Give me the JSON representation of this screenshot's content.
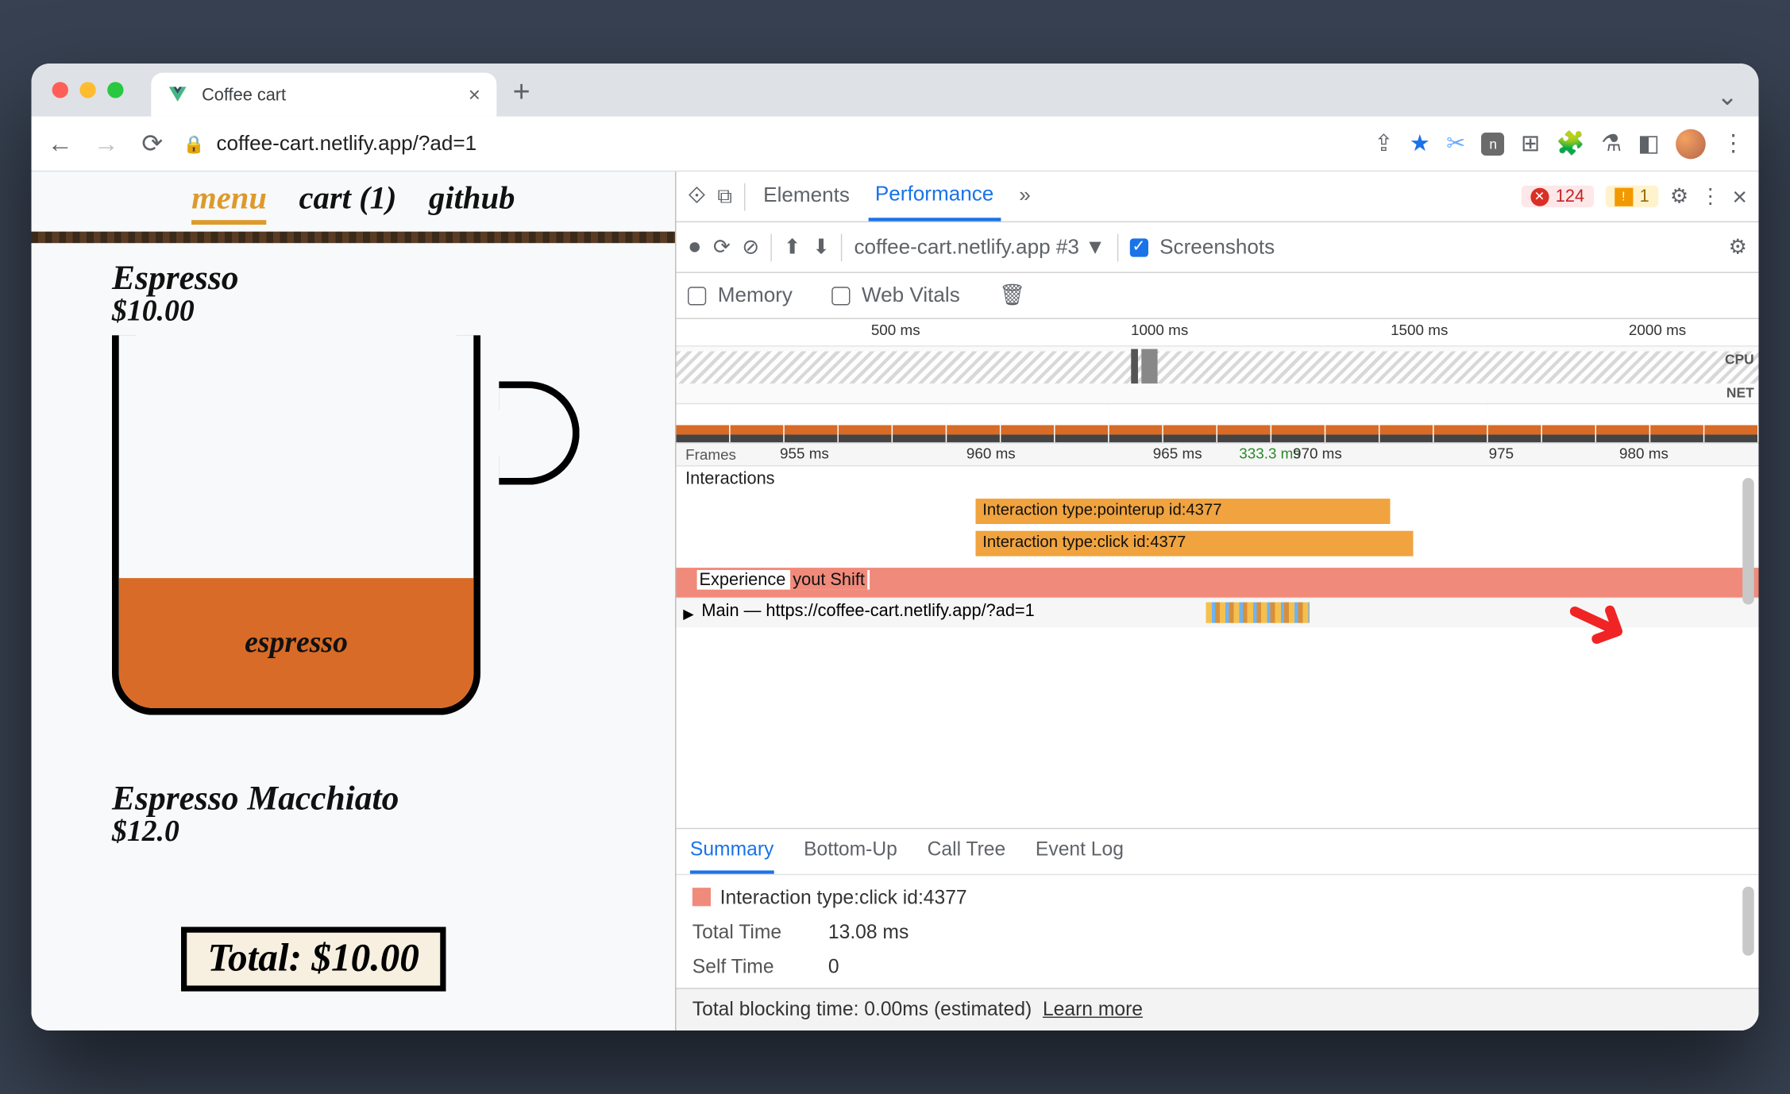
{
  "browser": {
    "tab_title": "Coffee cart",
    "url": "coffee-cart.netlify.app/?ad=1"
  },
  "page": {
    "nav": {
      "menu": "menu",
      "cart": "cart (1)",
      "github": "github"
    },
    "product1": {
      "name": "Espresso",
      "price": "$10.00",
      "fill_label": "espresso"
    },
    "product2": {
      "name": "Espresso Macchiato",
      "price": "$12.0"
    },
    "total_label": "Total: $10.00"
  },
  "devtools": {
    "tabs": {
      "elements": "Elements",
      "performance": "Performance",
      "more": "»"
    },
    "errors": "124",
    "warnings": "1",
    "recording_select": "coffee-cart.netlify.app #3",
    "screenshots_label": "Screenshots",
    "memory_label": "Memory",
    "webvitals_label": "Web Vitals",
    "overview_ticks": {
      "t1": "500 ms",
      "t2": "1000 ms",
      "t3": "1500 ms",
      "t4": "2000 ms"
    },
    "overview_labels": {
      "cpu": "CPU",
      "net": "NET"
    },
    "frames_label": "Frames",
    "frames_fps": "333.3 ms",
    "ruler_ticks": {
      "a": "955 ms",
      "b": "960 ms",
      "c": "965 ms",
      "d": "970 ms",
      "e": "975",
      "f": "980 ms"
    },
    "interactions_label": "Interactions",
    "interaction1": "Interaction type:pointerup id:4377",
    "interaction2": "Interaction type:click id:4377",
    "experience_label": "Experience",
    "experience_text": "yout Shift",
    "main_label": "Main — https://coffee-cart.netlify.app/?ad=1",
    "bottom_tabs": {
      "summary": "Summary",
      "bottomup": "Bottom-Up",
      "calltree": "Call Tree",
      "eventlog": "Event Log"
    },
    "summary": {
      "title": "Interaction type:click id:4377",
      "total_k": "Total Time",
      "total_v": "13.08 ms",
      "self_k": "Self Time",
      "self_v": "0"
    },
    "footer": {
      "text": "Total blocking time: 0.00ms (estimated)",
      "learn": "Learn more"
    }
  }
}
